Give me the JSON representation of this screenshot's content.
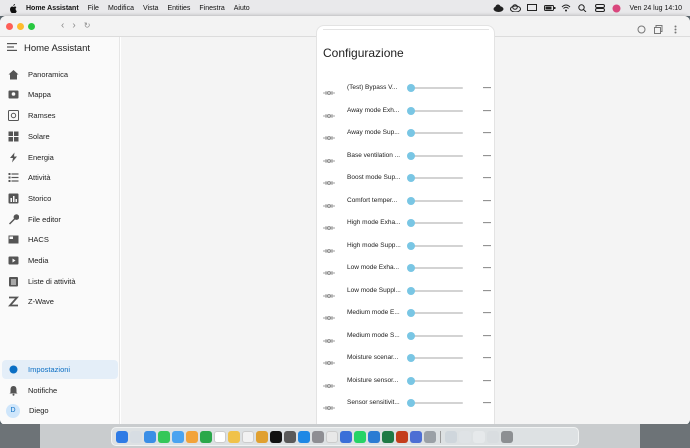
{
  "menubar": {
    "app_name": "Home Assistant",
    "menus": [
      "File",
      "Modifica",
      "Vista",
      "Entities",
      "Finestra",
      "Aiuto"
    ],
    "datetime": "Ven 24 lug  14:10"
  },
  "sidebar": {
    "title": "Home Assistant",
    "items": [
      {
        "label": "Panoramica",
        "icon": "view-dashboard-icon"
      },
      {
        "label": "Mappa",
        "icon": "map-icon"
      },
      {
        "label": "Ramses",
        "icon": "ramses-icon"
      },
      {
        "label": "Solare",
        "icon": "solar-icon"
      },
      {
        "label": "Energia",
        "icon": "lightning-icon"
      },
      {
        "label": "Attività",
        "icon": "list-icon"
      },
      {
        "label": "Storico",
        "icon": "chart-icon"
      },
      {
        "label": "File editor",
        "icon": "wrench-icon"
      },
      {
        "label": "HACS",
        "icon": "hacs-icon"
      },
      {
        "label": "Media",
        "icon": "media-icon"
      },
      {
        "label": "Liste di attività",
        "icon": "clipboard-list-icon"
      },
      {
        "label": "Z-Wave",
        "icon": "zwave-icon"
      }
    ],
    "settings_label": "Impostazioni",
    "notifications_label": "Notifiche",
    "user_initial": "D",
    "user_name": "Diego"
  },
  "card": {
    "title": "Configurazione",
    "rows": [
      {
        "label": "(Test) Bypass V...",
        "value": "—",
        "level": 0
      },
      {
        "label": "Away mode Exh...",
        "value": "—",
        "level": 0
      },
      {
        "label": "Away mode Sup...",
        "value": "—",
        "level": 0
      },
      {
        "label": "Base ventilation ...",
        "value": "—",
        "level": 0
      },
      {
        "label": "Boost mode Sup...",
        "value": "—",
        "level": 0
      },
      {
        "label": "Comfort temper...",
        "value": "—",
        "level": 0
      },
      {
        "label": "High mode Exha...",
        "value": "—",
        "level": 0
      },
      {
        "label": "High mode Supp...",
        "value": "—",
        "level": 0
      },
      {
        "label": "Low mode Exha...",
        "value": "—",
        "level": 0
      },
      {
        "label": "Low mode Suppl...",
        "value": "—",
        "level": 0
      },
      {
        "label": "Medium mode E...",
        "value": "—",
        "level": 0
      },
      {
        "label": "Medium mode S...",
        "value": "—",
        "level": 0
      },
      {
        "label": "Moisture scenar...",
        "value": "—",
        "level": 0
      },
      {
        "label": "Moisture sensor...",
        "value": "—",
        "level": 0
      },
      {
        "label": "Sensor sensitivit...",
        "value": "—",
        "level": 0
      }
    ]
  },
  "colors": {
    "accent": "#0b6fc4",
    "slider_thumb": "#79c6e4",
    "active_bg": "#e4eef8"
  }
}
